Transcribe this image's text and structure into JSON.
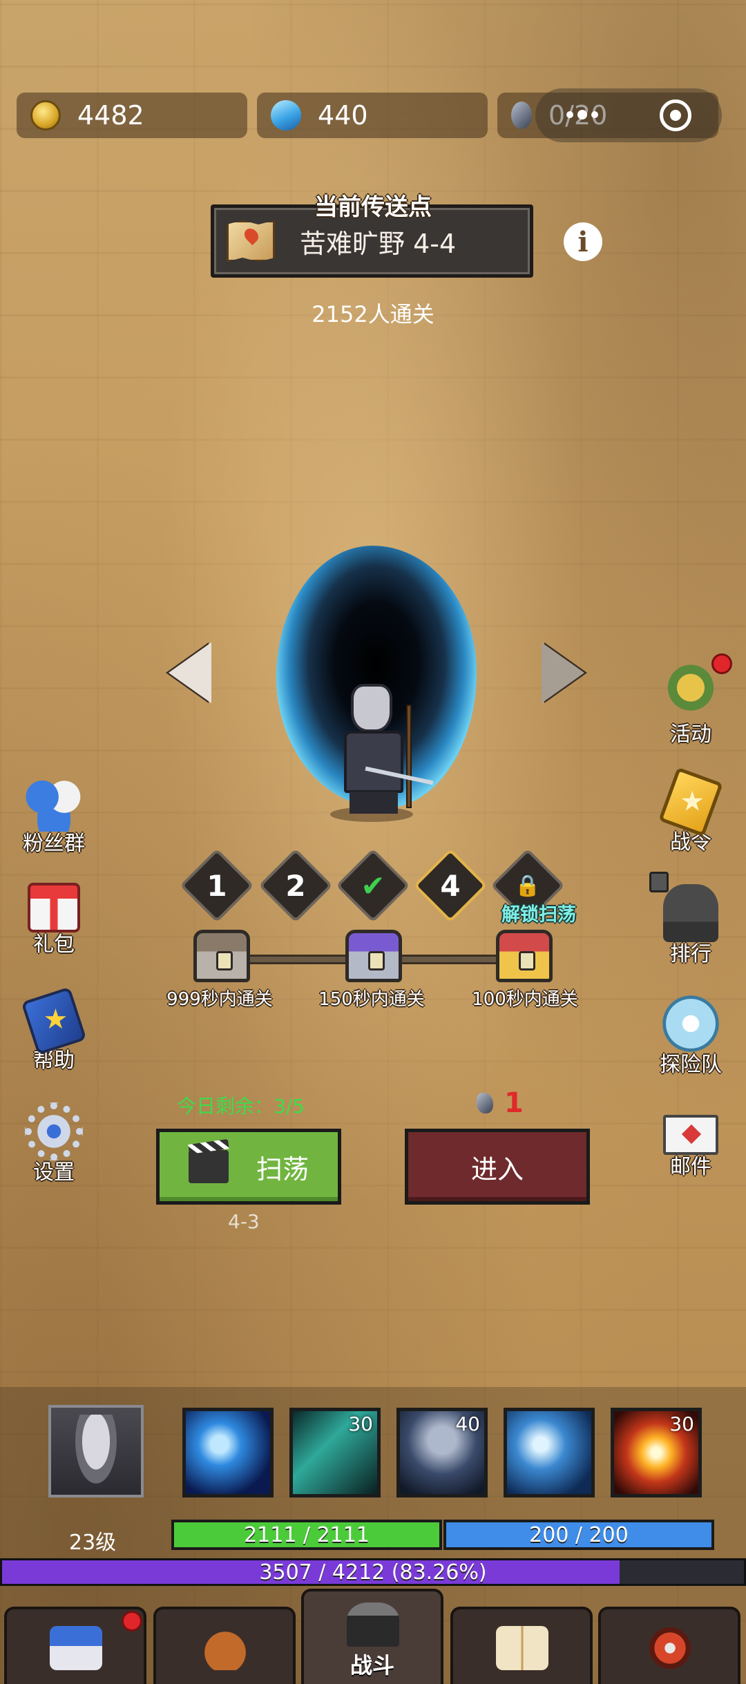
{
  "resources": {
    "gold": "4482",
    "gems": "440",
    "stamina": "0/20"
  },
  "location": {
    "label": "当前传送点",
    "name": "苦难旷野 4-4",
    "cleared_count": "2152人通关"
  },
  "difficulty": {
    "items": [
      "1",
      "2",
      "✔",
      "4",
      "🔒"
    ],
    "unlock_label": "解锁扫荡"
  },
  "chests": [
    {
      "label": "999秒内通关"
    },
    {
      "label": "150秒内通关"
    },
    {
      "label": "100秒内通关"
    }
  ],
  "left_menu": {
    "fans": "粉丝群",
    "gift": "礼包",
    "help": "帮助",
    "settings": "设置"
  },
  "right_menu": {
    "activity": "活动",
    "pass": "战令",
    "rank": "排行",
    "team": "探险队",
    "mail": "邮件"
  },
  "sweep": {
    "today_remaining": "今日剩余：3/5",
    "label": "扫荡",
    "prev_stage": "4-3"
  },
  "enter": {
    "label": "进入",
    "cost": "1"
  },
  "player": {
    "level": "23级",
    "hp": "2111 / 2111",
    "mp": "200 / 200",
    "xp": "3507 / 4212 (83.26%)",
    "xp_fraction": 0.8326
  },
  "skills": [
    {
      "count": ""
    },
    {
      "count": "30"
    },
    {
      "count": "40"
    },
    {
      "count": ""
    },
    {
      "count": "30"
    }
  ],
  "tabs": {
    "battle": "战斗"
  },
  "icons": [
    "coin-icon",
    "gem-icon",
    "stone-icon",
    "more-icon",
    "target-icon",
    "map-icon",
    "info-icon"
  ],
  "colors": {
    "sweep_button": "#71b540",
    "enter_button": "#6e2a2c",
    "hp": "#4ccb3a",
    "mp": "#3f8de8",
    "xp": "#7a3ad8",
    "today_text": "#3ddc4a",
    "cost_text": "#e02a2a"
  }
}
